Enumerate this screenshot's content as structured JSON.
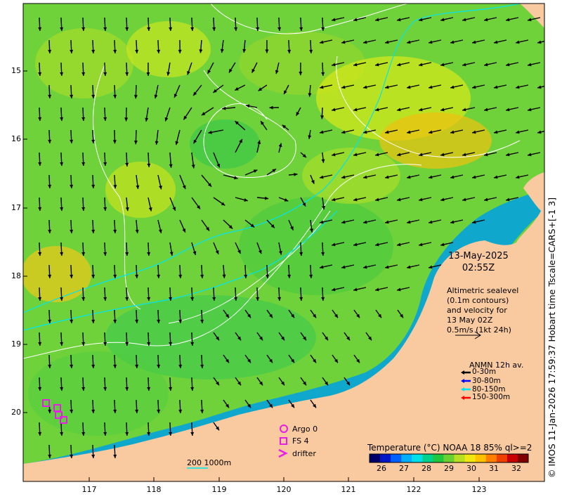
{
  "map": {
    "lat_ticks": [
      "15",
      "16",
      "17",
      "18",
      "19",
      "20"
    ],
    "lon_ticks": [
      "117",
      "118",
      "119",
      "120",
      "121",
      "122",
      "123"
    ],
    "land_color": "#f9c9a0",
    "ocean_base_color": "#6fd23a"
  },
  "timestamp": {
    "date": "13-May-2025",
    "time": "02:55Z"
  },
  "description": {
    "line1": "Altimetric sealevel",
    "line2": "(0.1m contours)",
    "line3": "and velocity for",
    "line4": "13 May 02Z",
    "line5": "0.5m/s (1kt 24h)"
  },
  "anmn": {
    "title": "ANMN 12h av.",
    "rows": [
      {
        "label": "0-30m",
        "color": "#000000"
      },
      {
        "label": "30-80m",
        "color": "#0000ff"
      },
      {
        "label": "80-150m",
        "color": "#00e5ee"
      },
      {
        "label": "150-300m",
        "color": "#ff0000"
      }
    ]
  },
  "symbols": {
    "argo": "Argo 0",
    "fs": "FS 4",
    "drifter": "drifter",
    "accent": "#e81ee8"
  },
  "bathymetry": {
    "label": "200  1000m",
    "color": "#00e5ee"
  },
  "colorbar": {
    "title": "Temperature (°C) NOAA 18 85% ql>=2",
    "ticks": [
      "26",
      "27",
      "28",
      "29",
      "30",
      "31",
      "32"
    ],
    "colors": [
      "#00006a",
      "#0016c8",
      "#0060ff",
      "#00b0ff",
      "#00e0e8",
      "#00d28c",
      "#20c840",
      "#6ad230",
      "#b8e020",
      "#f0e610",
      "#ffc000",
      "#ff8000",
      "#f04000",
      "#c80000",
      "#800000"
    ]
  },
  "copyright": "© IMOS 11-Jan-2026 17:59:37 Hobart time Tscale=CARS+[-1 3]"
}
